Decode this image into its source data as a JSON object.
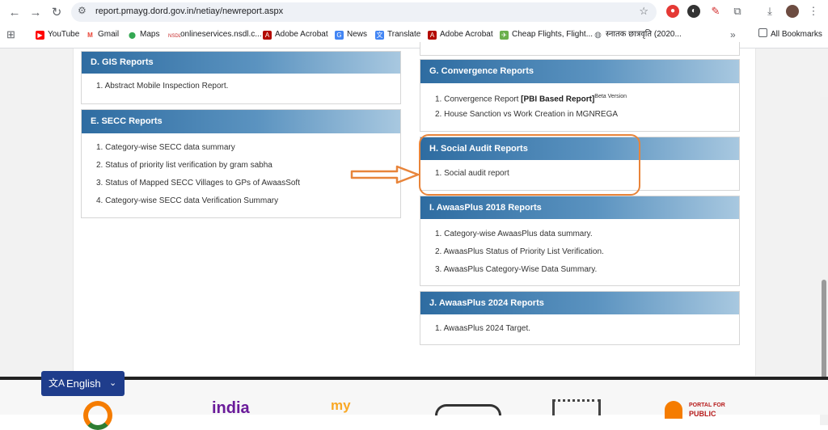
{
  "browser": {
    "url": "report.pmayg.dord.gov.in/netiay/newreport.aspx",
    "bookmarks": [
      {
        "label": "YouTube",
        "icon": "youtube-icon",
        "color": "#ff0000"
      },
      {
        "label": "Gmail",
        "icon": "gmail-icon",
        "color": "#ea4335"
      },
      {
        "label": "Maps",
        "icon": "maps-icon",
        "color": "#34a853"
      },
      {
        "label": "onlineservices.nsdl.c...",
        "icon": "nsdl-icon",
        "color": "#c62828"
      },
      {
        "label": "Adobe Acrobat",
        "icon": "acrobat-icon",
        "color": "#b30b00"
      },
      {
        "label": "News",
        "icon": "news-icon",
        "color": "#4285f4"
      },
      {
        "label": "Translate",
        "icon": "translate-icon",
        "color": "#4285f4"
      },
      {
        "label": "Adobe Acrobat",
        "icon": "acrobat-icon",
        "color": "#b30b00"
      },
      {
        "label": "Cheap Flights, Flight...",
        "icon": "flights-icon",
        "color": "#6ab04c"
      },
      {
        "label": "स्नातक छात्रवृति (2020...",
        "icon": "globe-icon",
        "color": "#5f6368"
      }
    ],
    "all_bookmarks": "All Bookmarks"
  },
  "sections": {
    "gis": {
      "title": "D. GIS Reports",
      "items": [
        "1. Abstract Mobile Inspection Report."
      ]
    },
    "secc": {
      "title": "E. SECC Reports",
      "items": [
        "1. Category-wise SECC data summary",
        "2. Status of priority list verification by gram sabha",
        "3. Status of Mapped SECC Villages to GPs of AwaasSoft",
        "4. Category-wise SECC data Verification Summary"
      ]
    },
    "convergence": {
      "title": "G. Convergence Reports",
      "item1_prefix": "1. Convergence Report ",
      "item1_bold": "[PBI Based Report]",
      "item1_sup": "Beta Version",
      "item2": "2. House Sanction vs Work Creation in MGNREGA"
    },
    "social_audit": {
      "title": "H. Social Audit Reports",
      "items": [
        "1. Social audit report"
      ]
    },
    "awaasplus2018": {
      "title": "I. AwaasPlus 2018 Reports",
      "items": [
        "1. Category-wise AwaasPlus data summary.",
        "2. AwaasPlus Status of Priority List Verification.",
        "3. AwaasPlus Category-Wise Data Summary."
      ]
    },
    "awaasplus2024": {
      "title": "J. AwaasPlus 2024 Reports",
      "items": [
        "1. AwaasPlus 2024 Target."
      ]
    }
  },
  "language": {
    "label": "English"
  },
  "footer": {
    "india_logo": "india",
    "mygov_logo": "my",
    "portal_line1": "PORTAL FOR",
    "portal_line2": "PUBLIC"
  },
  "colors": {
    "highlight": "#e8843a",
    "header_blue": "#2e6ca1",
    "lang_button": "#1f3d8c"
  }
}
